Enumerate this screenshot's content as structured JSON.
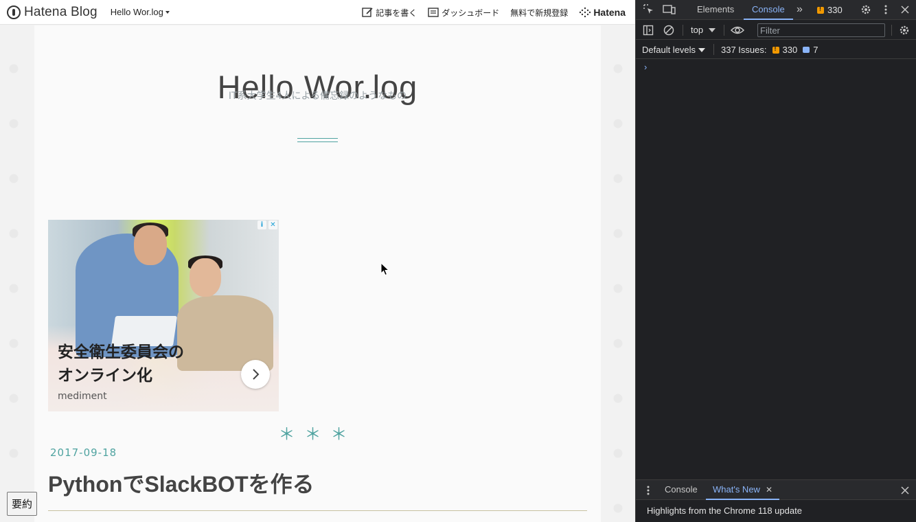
{
  "browser_page": {
    "hatena_bar": {
      "logo_text": "Hatena Blog",
      "blog_selector": "Hello Wor.log",
      "write_article": "記事を書く",
      "dashboard": "ダッシュボード",
      "signup": "無料で新規登録",
      "hatena": "Hatena"
    },
    "header": {
      "title": "Hello Wor.log",
      "description": "IT系大学生4人による備忘録のようなもの"
    },
    "ad": {
      "headline_line1": "安全衛生委員会の",
      "headline_line2": "オンライン化",
      "brand": "mediment",
      "info_glyph": "i",
      "close_glyph": "✕",
      "next_glyph": "›"
    },
    "divider": "＊＊＊",
    "entry": {
      "date": "2017-09-18",
      "title": "PythonでSlackBOTを作る"
    },
    "summary_button": "要約"
  },
  "devtools": {
    "tabs": [
      "Elements",
      "Console"
    ],
    "active_tab": "Console",
    "more_tabs_glyph": "»",
    "issue_badge_count": "330",
    "toolbar": {
      "context": "top",
      "filter_placeholder": "Filter"
    },
    "levels": "Default levels",
    "issues_label": "337 Issues:",
    "issues_warnings": "330",
    "issues_info": "7",
    "prompt": "›",
    "drawer": {
      "tabs": [
        "Console",
        "What's New"
      ],
      "active_tab": "What's New",
      "close_tab_glyph": "✕",
      "message": "Highlights from the Chrome 118 update"
    },
    "colors": {
      "background": "#202124",
      "accent": "#8ab4f8",
      "warning": "#f29900"
    }
  },
  "colors": {
    "accent_teal": "#4fa3a0",
    "title_gray": "#444444"
  }
}
